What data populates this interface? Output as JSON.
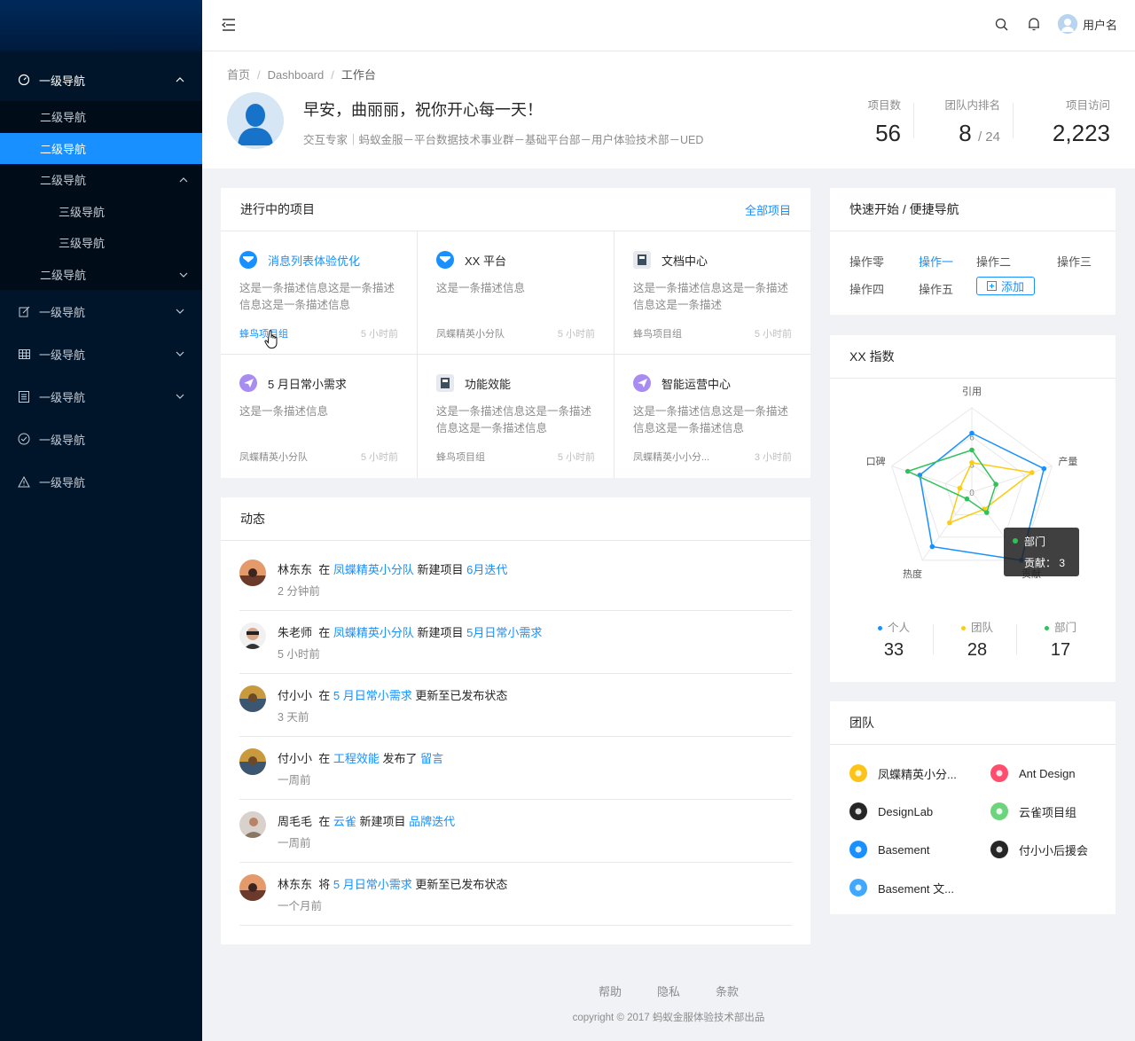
{
  "sidebar": {
    "items": [
      {
        "label": "一级导航",
        "icon": "dashboard-icon"
      },
      {
        "label": "二级导航"
      },
      {
        "label": "二级导航"
      },
      {
        "label": "二级导航"
      },
      {
        "label": "三级导航"
      },
      {
        "label": "三级导航"
      },
      {
        "label": "二级导航"
      },
      {
        "label": "一级导航",
        "icon": "edit-icon"
      },
      {
        "label": "一级导航",
        "icon": "table-icon"
      },
      {
        "label": "一级导航",
        "icon": "profile-icon"
      },
      {
        "label": "一级导航",
        "icon": "check-circle-icon"
      },
      {
        "label": "一级导航",
        "icon": "warning-icon"
      }
    ]
  },
  "header": {
    "username": "用户名"
  },
  "breadcrumb": [
    "首页",
    "Dashboard",
    "工作台"
  ],
  "welcome": {
    "greeting": "早安，曲丽丽，祝你开心每一天！",
    "subtitle": "交互专家｜蚂蚁金服－平台数据技术事业群－基础平台部－用户体验技术部－UED"
  },
  "stats": [
    {
      "label": "项目数",
      "value": "56"
    },
    {
      "label": "团队内排名",
      "value": "8",
      "suffix": "/ 24"
    },
    {
      "label": "项目访问",
      "value": "2,223"
    }
  ],
  "projects_card": {
    "title": "进行中的项目",
    "link": "全部项目",
    "items": [
      {
        "title": "消息列表体验优化",
        "desc": "这是一条描述信息这是一条描述信息这是一条描述信息",
        "group": "蜂鸟项目组",
        "time": "5 小时前"
      },
      {
        "title": "XX 平台",
        "desc": "这是一条描述信息",
        "group": "凤蝶精英小分队",
        "time": "5 小时前"
      },
      {
        "title": "文档中心",
        "desc": "这是一条描述信息这是一条描述信息这是一条描述",
        "group": "蜂鸟项目组",
        "time": "5 小时前"
      },
      {
        "title": "5 月日常小需求",
        "desc": "这是一条描述信息",
        "group": "凤蝶精英小分队",
        "time": "5 小时前"
      },
      {
        "title": "功能效能",
        "desc": "这是一条描述信息这是一条描述信息这是一条描述信息",
        "group": "蜂鸟项目组",
        "time": "5 小时前"
      },
      {
        "title": "智能运营中心",
        "desc": "这是一条描述信息这是一条描述信息这是一条描述信息",
        "group": "凤蝶精英小小分...",
        "time": "3 小时前"
      }
    ]
  },
  "activity_card": {
    "title": "动态",
    "items": [
      {
        "user": "林东东",
        "verb": "在",
        "target": "凤蝶精英小分队",
        "action": "新建项目",
        "object": "6月迭代",
        "time": "2 分钟前"
      },
      {
        "user": "朱老师",
        "verb": "在",
        "target": "凤蝶精英小分队",
        "action": "新建项目",
        "object": "5月日常小需求",
        "time": "5 小时前"
      },
      {
        "user": "付小小",
        "verb": "在",
        "target": "5 月日常小需求",
        "action": "更新至已发布状态",
        "object": "",
        "time": "3 天前"
      },
      {
        "user": "付小小",
        "verb": "在",
        "target": "工程效能",
        "action": "发布了",
        "object": "留言",
        "time": "一周前"
      },
      {
        "user": "周毛毛",
        "verb": "在",
        "target": "云雀",
        "action": "新建项目",
        "object": "品牌迭代",
        "time": "一周前"
      },
      {
        "user": "林东东",
        "verb": "将",
        "target": "5 月日常小需求",
        "action": "更新至已发布状态",
        "object": "",
        "time": "一个月前"
      }
    ]
  },
  "quick_card": {
    "title": "快速开始 / 便捷导航",
    "items": [
      "操作零",
      "操作一",
      "操作二",
      "操作三",
      "操作四",
      "操作五"
    ],
    "add_label": "添加"
  },
  "chart_data": {
    "type": "radar",
    "title": "XX 指数",
    "axes": [
      "引用",
      "产量",
      "贡献",
      "热度",
      "口碑"
    ],
    "ticks": [
      "0",
      "3",
      "6"
    ],
    "series": [
      {
        "name": "个人",
        "color": "#1890ff",
        "values": [
          7,
          9,
          10,
          8,
          6.5
        ]
      },
      {
        "name": "团队",
        "color": "#facc14",
        "values": [
          3.5,
          7.5,
          2.5,
          4.5,
          1.5
        ]
      },
      {
        "name": "部门",
        "color": "#2fc25b",
        "values": [
          5,
          3,
          3,
          1,
          8
        ]
      }
    ],
    "tooltip": {
      "series": "部门",
      "label": "贡献：",
      "value": "3"
    },
    "legend": [
      {
        "name": "个人",
        "value": "33"
      },
      {
        "name": "团队",
        "value": "28"
      },
      {
        "name": "部门",
        "value": "17"
      }
    ]
  },
  "team_card": {
    "title": "团队",
    "items": [
      {
        "name": "凤蝶精英小分...",
        "color": "#fcc419"
      },
      {
        "name": "Ant Design",
        "color": "#ff4d6d"
      },
      {
        "name": "DesignLab",
        "color": "#262626"
      },
      {
        "name": "云雀项目组",
        "color": "#6dd47e"
      },
      {
        "name": "Basement",
        "color": "#1890ff"
      },
      {
        "name": "付小小后援会",
        "color": "#262626"
      },
      {
        "name": "Basement 文...",
        "color": "#40a9ff"
      }
    ]
  },
  "footer": {
    "links": [
      "帮助",
      "隐私",
      "条款"
    ],
    "copyright": "copyright © 2017 蚂蚁金服体验技术部出品"
  }
}
